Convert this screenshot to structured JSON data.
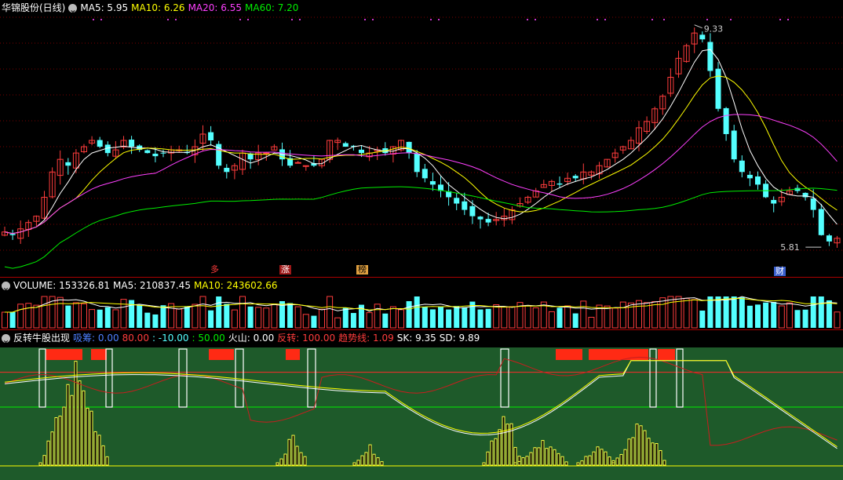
{
  "header": {
    "stock_name": "华锦股份(日线)",
    "ma5_label": "MA5: 5.95",
    "ma10_label": "MA10: 6.26",
    "ma20_label": "MA20: 6.55",
    "ma60_label": "MA60: 7.20"
  },
  "main": {
    "high_label": "9.33",
    "low_label": "5.81",
    "tags": {
      "duo": "多",
      "zhang": "涨",
      "bang": "榜",
      "cai": "财"
    }
  },
  "volume": {
    "title": "VOLUME: 153326.81",
    "ma5": "MA5: 210837.45",
    "ma10": "MA10: 243602.66"
  },
  "indicator": {
    "title": "反转牛股出现",
    "xichou": "吸筹: 0.00",
    "v80": "80.00",
    "vneg10": ": -10.00",
    "v50": ": 50.00",
    "huoshan": "火山: 0.00",
    "fanzhuan": "反转: 100.00",
    "qushi": "趋势线: 1.09",
    "sk": "SK: 9.35",
    "sd": "SD: 9.89"
  },
  "colors": {
    "up": "#ff3c3c",
    "down": "#54ffff",
    "ma5": "#ffffff",
    "ma10": "#ffff00",
    "ma20": "#ff40ff",
    "ma60": "#00ee00",
    "ind_bg": "#1e5a2a"
  },
  "chart_data": {
    "type": "candlestick",
    "high": 9.33,
    "low": 5.81,
    "closes": [
      6.05,
      6.0,
      6.1,
      6.2,
      6.3,
      6.6,
      7.0,
      7.2,
      7.1,
      7.3,
      7.4,
      7.5,
      7.4,
      7.3,
      7.35,
      7.5,
      7.4,
      7.35,
      7.3,
      7.25,
      7.3,
      7.35,
      7.35,
      7.3,
      7.4,
      7.6,
      7.5,
      7.1,
      7.0,
      7.1,
      7.3,
      7.2,
      7.3,
      7.3,
      7.4,
      7.2,
      7.1,
      7.15,
      7.1,
      7.1,
      7.2,
      7.5,
      7.5,
      7.4,
      7.4,
      7.3,
      7.3,
      7.35,
      7.3,
      7.4,
      7.5,
      7.3,
      7.0,
      6.9,
      6.8,
      6.7,
      6.6,
      6.5,
      6.4,
      6.3,
      6.25,
      6.2,
      6.25,
      6.3,
      6.4,
      6.5,
      6.6,
      6.7,
      6.8,
      6.85,
      6.8,
      6.9,
      6.9,
      7.0,
      7.0,
      7.1,
      7.2,
      7.3,
      7.4,
      7.5,
      7.7,
      7.8,
      8.0,
      8.2,
      8.5,
      8.8,
      9.0,
      9.2,
      9.1,
      8.6,
      8.0,
      7.6,
      7.2,
      7.0,
      6.9,
      6.8,
      6.6,
      6.5,
      6.6,
      6.7,
      6.7,
      6.6,
      6.4,
      6.0,
      5.9,
      5.95
    ]
  }
}
